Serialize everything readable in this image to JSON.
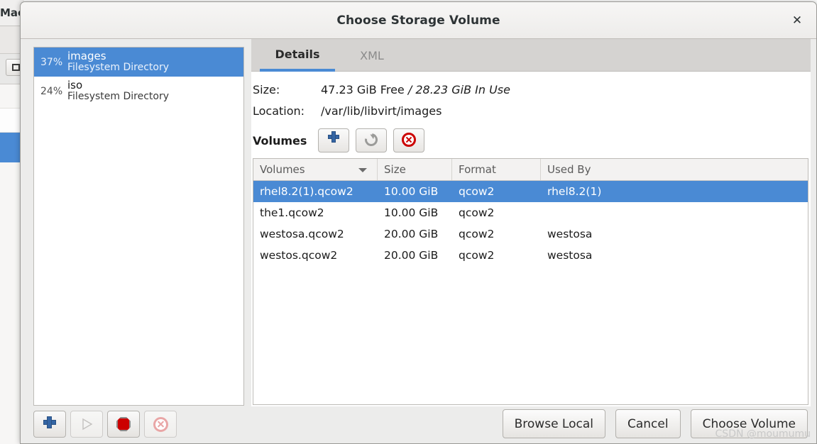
{
  "background_window": {
    "title_fragment": "Mac"
  },
  "dialog": {
    "title": "Choose Storage Volume",
    "close_icon": "close-icon"
  },
  "pool_list": {
    "items": [
      {
        "percent": "37%",
        "name": "images",
        "type": "Filesystem Directory",
        "selected": true
      },
      {
        "percent": "24%",
        "name": "iso",
        "type": "Filesystem Directory",
        "selected": false
      }
    ]
  },
  "tabs": [
    {
      "label": "Details",
      "active": true
    },
    {
      "label": "XML",
      "active": false
    }
  ],
  "details": {
    "size_label": "Size:",
    "size_free": "47.23 GiB Free",
    "size_separator": "/",
    "size_in_use": "28.23 GiB In Use",
    "location_label": "Location:",
    "location_value": "/var/lib/libvirt/images"
  },
  "volumes_toolbar": {
    "label": "Volumes",
    "buttons": [
      {
        "name": "add-volume-button",
        "icon": "plus-icon",
        "enabled": true
      },
      {
        "name": "refresh-volumes-button",
        "icon": "refresh-icon",
        "enabled": true
      },
      {
        "name": "delete-volume-button",
        "icon": "delete-circle-icon",
        "enabled": true
      }
    ]
  },
  "volumes_table": {
    "columns": [
      "Volumes",
      "Size",
      "Format",
      "Used By"
    ],
    "sort_column": "Volumes",
    "sort_direction": "descending",
    "rows": [
      {
        "volume": "rhel8.2(1).qcow2",
        "size": "10.00 GiB",
        "format": "qcow2",
        "used_by": "rhel8.2(1)",
        "selected": true
      },
      {
        "volume": "the1.qcow2",
        "size": "10.00 GiB",
        "format": "qcow2",
        "used_by": "",
        "selected": false
      },
      {
        "volume": "westosa.qcow2",
        "size": "20.00 GiB",
        "format": "qcow2",
        "used_by": "westosa",
        "selected": false
      },
      {
        "volume": "westos.qcow2",
        "size": "20.00 GiB",
        "format": "qcow2",
        "used_by": "westosa",
        "selected": false
      }
    ]
  },
  "pool_controls": [
    {
      "name": "add-pool-button",
      "icon": "plus-icon",
      "enabled": true
    },
    {
      "name": "start-pool-button",
      "icon": "play-icon",
      "enabled": false
    },
    {
      "name": "stop-pool-button",
      "icon": "stop-octagon-icon",
      "enabled": true
    },
    {
      "name": "delete-pool-button",
      "icon": "delete-circle-icon",
      "enabled": false
    }
  ],
  "actions": {
    "browse_local": "Browse Local",
    "cancel": "Cancel",
    "choose_volume": "Choose Volume"
  },
  "watermark": "CSDN @moumumu",
  "colors": {
    "selection_blue": "#4a8ad4",
    "accent_underline": "#4a8ad4",
    "delete_red": "#cc0000",
    "plus_blue": "#3465a4",
    "dialog_bg": "#ececeb",
    "tabstrip_bg": "#d5d3d1"
  }
}
